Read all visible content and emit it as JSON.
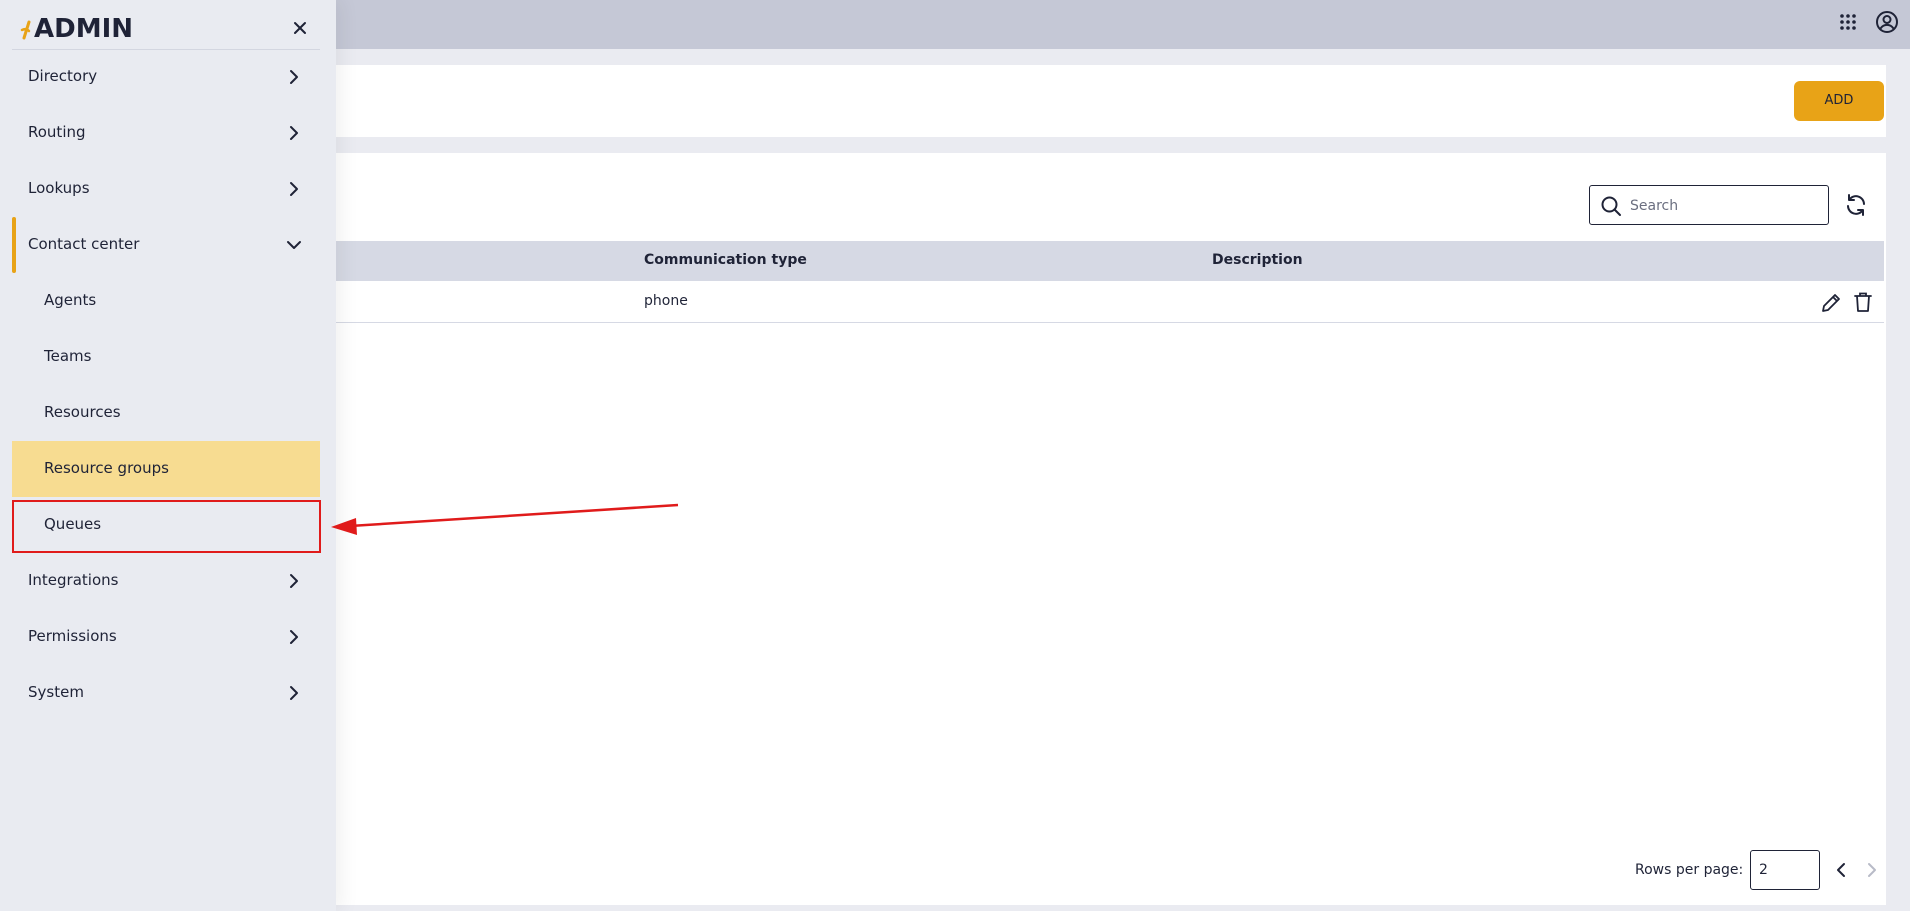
{
  "app": {
    "brand": "ADMIN",
    "colors": {
      "accent": "#e8a317",
      "active_bg": "#f7dc91",
      "annotation": "#e01b1b"
    }
  },
  "topbar": {
    "apps_icon": "grid-apps-icon",
    "account_icon": "account-circle-icon"
  },
  "header": {
    "add_label": "ADD"
  },
  "search": {
    "placeholder": "Search"
  },
  "table": {
    "columns": [
      "Communication type",
      "Description"
    ],
    "rows": [
      {
        "communication_type": "phone",
        "description": ""
      }
    ]
  },
  "pagination": {
    "rows_per_page_label": "Rows per page:",
    "rows_per_page_value": "2"
  },
  "sidebar": {
    "items": [
      {
        "label": "Directory"
      },
      {
        "label": "Routing"
      },
      {
        "label": "Lookups"
      },
      {
        "label": "Contact center"
      },
      {
        "label": "Agents"
      },
      {
        "label": "Teams"
      },
      {
        "label": "Resources"
      },
      {
        "label": "Resource groups"
      },
      {
        "label": "Queues"
      },
      {
        "label": "Integrations"
      },
      {
        "label": "Permissions"
      },
      {
        "label": "System"
      }
    ]
  }
}
